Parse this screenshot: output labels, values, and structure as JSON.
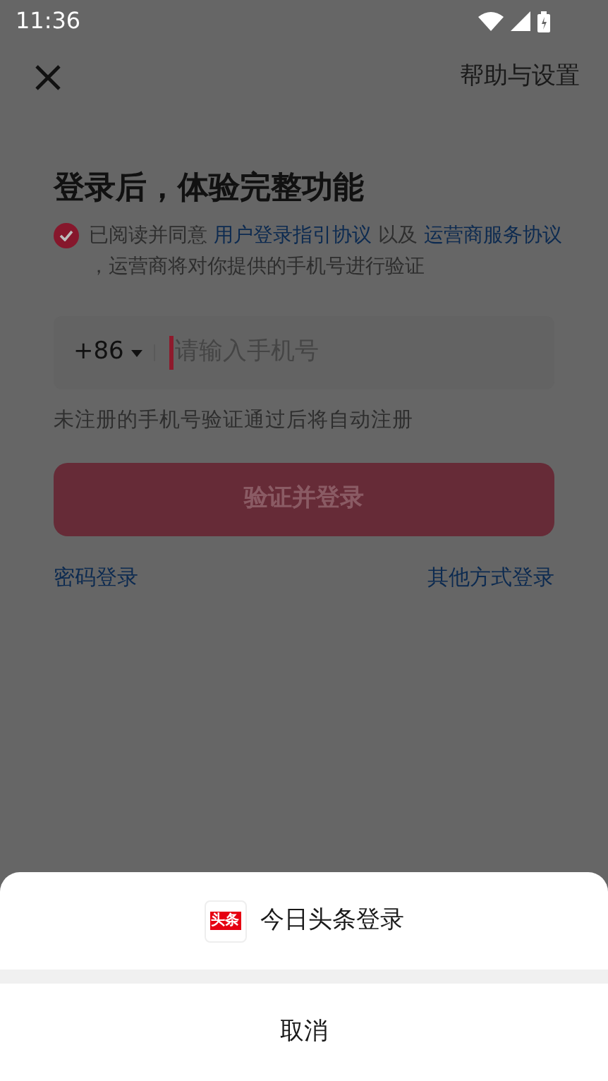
{
  "status_bar": {
    "time": "11:36"
  },
  "header": {
    "help": "帮助与设置"
  },
  "title": "登录后，体验完整功能",
  "agreement": {
    "checked": true,
    "parts": [
      {
        "kind": "text",
        "text": "已阅读并同意 "
      },
      {
        "kind": "link",
        "text": "用户登录指引协议"
      },
      {
        "kind": "text",
        "text": " 以及 "
      },
      {
        "kind": "link",
        "text": "运营商服务协议"
      },
      {
        "kind": "text",
        "text": " ，运营商将对你提供的手机号进行验证"
      }
    ]
  },
  "phone": {
    "country_code": "+86",
    "placeholder": "请输入手机号"
  },
  "hint": "未注册的手机号验证通过后将自动注册",
  "submit_button": {
    "label": "验证并登录",
    "disabled": true
  },
  "links": [
    "密码登录",
    "其他方式登录"
  ],
  "sheet": {
    "options": [
      {
        "logo_text": "头条",
        "label": "今日头条登录"
      }
    ],
    "cancel": "取消"
  }
}
